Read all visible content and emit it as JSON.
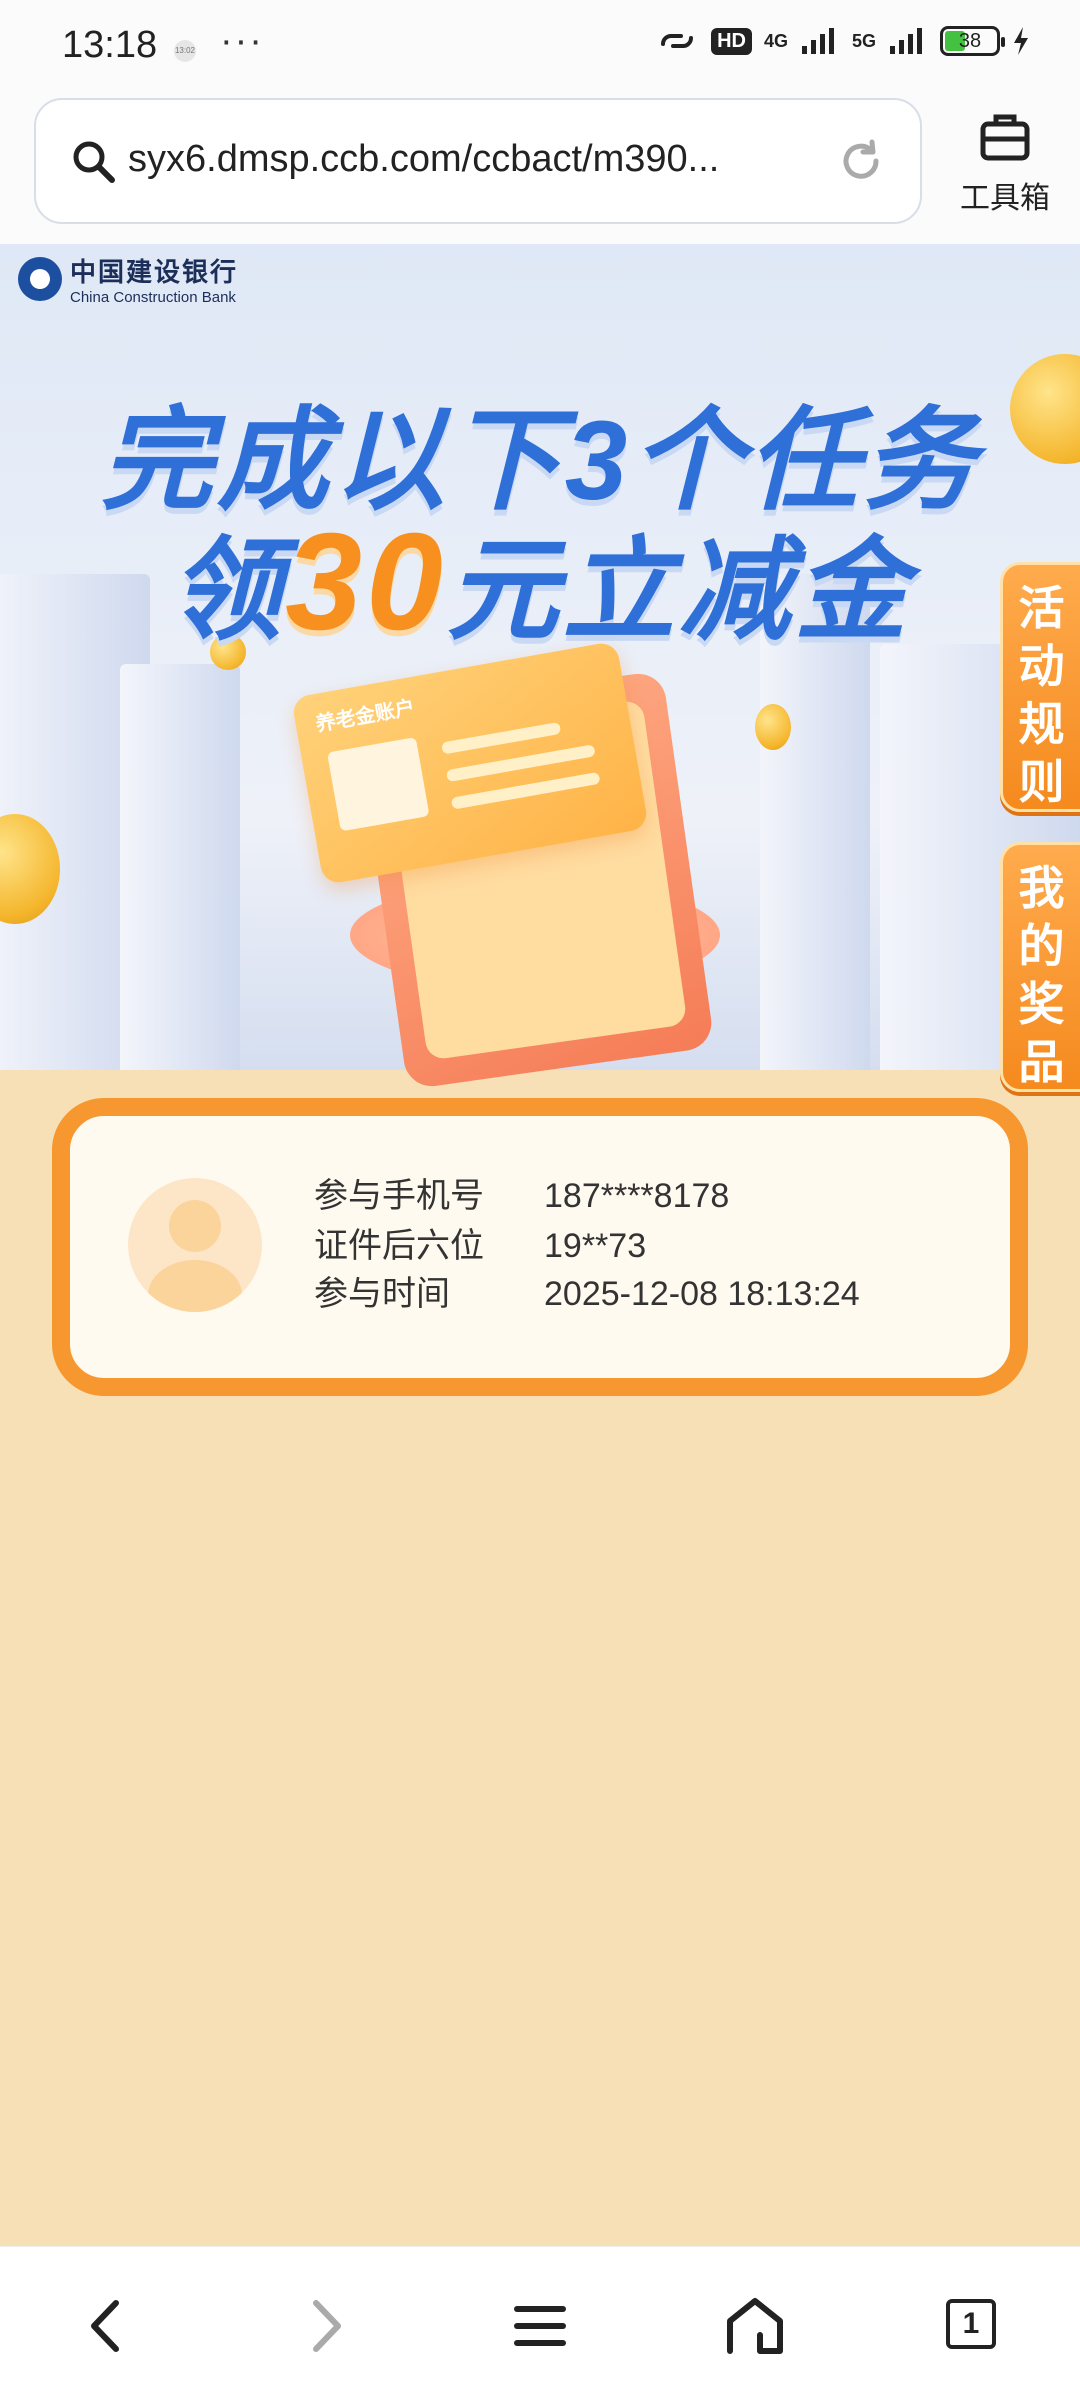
{
  "status_bar": {
    "time": "13:18",
    "mini_icon_text": "13:02",
    "more": "···",
    "hd_badge": "HD",
    "net1": "4G",
    "net2": "5G",
    "battery": "38"
  },
  "browser": {
    "url": "syx6.dmsp.ccb.com/ccbact/m390...",
    "toolbox_label": "工具箱"
  },
  "banner": {
    "bank_name_cn": "中国建设银行",
    "bank_name_en": "China Construction Bank",
    "headline_line1": "完成以下3个任务",
    "headline_line2_prefix": "领",
    "headline_amount": "30",
    "headline_line2_suffix": "元立减金",
    "card_title": "养老金账户"
  },
  "side_tabs": {
    "rules": "活动规则",
    "prizes": "我的奖品"
  },
  "participant": {
    "phone_label": "参与手机号",
    "phone_value": "187****8178",
    "id_label": "证件后六位",
    "id_value": "19**73",
    "time_label": "参与时间",
    "time_value": "2025-12-08 18:13:24"
  },
  "bottom_nav": {
    "tab_count": "1"
  },
  "colors": {
    "page_bg": "#f7e0b6",
    "accent_orange": "#f6972f",
    "headline_blue": "#2f6fd8",
    "amount_orange": "#f7901e"
  }
}
